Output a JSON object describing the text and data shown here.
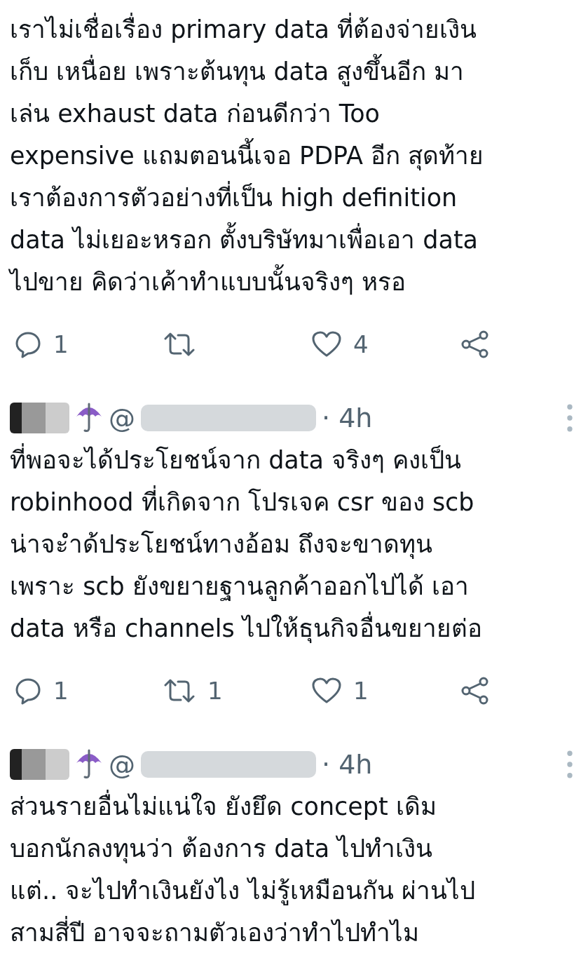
{
  "tweets": [
    {
      "lines": [
        "เราไม่เชื่อเรื่อง primary data ที่ต้องจ่ายเงิน",
        "เก็บ เหนื่อย เพราะต้นทุน data สูงขึ้นอีก มา",
        "เล่น exhaust data ก่อนดีกว่า Too",
        "expensive แถมตอนนี้เจอ PDPA อีก สุดท้าย",
        "เราต้องการตัวอย่างที่เป็น high definition",
        "data ไม่เยอะหรอก ตั้งบริษัทมาเพื่อเอา data",
        "ไปขาย คิดว่าเค้าทำแบบนั้นจริงๆ หรอ"
      ],
      "actions": {
        "replies": "1",
        "likes": "4"
      }
    },
    {
      "header": {
        "handle_prefix": "@",
        "time": "· 4h"
      },
      "lines": [
        "ที่พอจะได้ประโยชน์จาก data จริงๆ คงเป็น",
        "robinhood ที่เกิดจาก โปรเจค csr ของ scb",
        "น่าจะำด้ประโยชน์ทางอ้อม ถึงจะขาดทุน",
        "เพราะ scb ยังขยายฐานลูกค้าออกไปได้ เอา",
        "data หรือ channels ไปให้ธุนกิจอื่นขยายต่อ"
      ],
      "actions": {
        "replies": "1",
        "retweets": "1",
        "likes": "1"
      }
    },
    {
      "header": {
        "handle_prefix": "@",
        "time": "· 4h"
      },
      "lines": [
        "ส่วนรายอื่นไม่แน่ใจ ยังยึด concept เดิม",
        "บอกนักลงทุนว่า ต้องการ data ไปทำเงิน",
        "แต่.. จะไปทำเงินยังไง ไม่รู้เหมือนกัน ผ่านไป",
        "สามสี่ปี อาจจะถามตัวเองว่าทำไปทำไม"
      ]
    }
  ]
}
